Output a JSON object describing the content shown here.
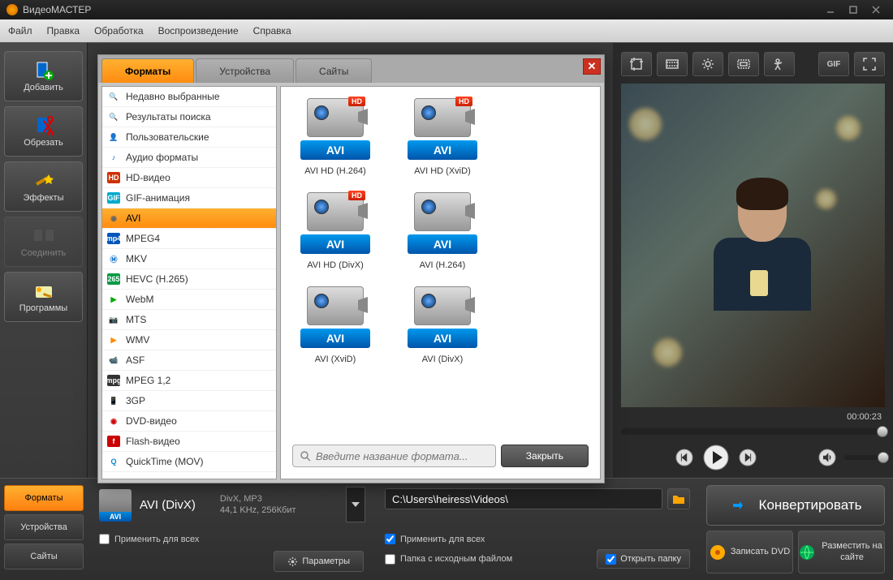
{
  "title": "ВидеоМАСТЕР",
  "menu": [
    "Файл",
    "Правка",
    "Обработка",
    "Воспроизведение",
    "Справка"
  ],
  "sidebar": {
    "items": [
      {
        "label": "Добавить",
        "name": "add-button"
      },
      {
        "label": "Обрезать",
        "name": "cut-button"
      },
      {
        "label": "Эффекты",
        "name": "effects-button"
      },
      {
        "label": "Соединить",
        "name": "join-button",
        "disabled": true
      },
      {
        "label": "Программы",
        "name": "programs-button"
      }
    ]
  },
  "preview": {
    "time": "00:00:23",
    "gif_label": "GIF"
  },
  "bottom_tabs": [
    "Форматы",
    "Устройства",
    "Сайты"
  ],
  "format": {
    "tag": "AVI",
    "name": "AVI (DivX)",
    "detail1": "DivX, MP3",
    "detail2": "44,1 KHz, 256Кбит",
    "apply_all": "Применить для всех",
    "params": "Параметры"
  },
  "path": {
    "value": "C:\\Users\\heiress\\Videos\\",
    "apply_all": "Применить для всех",
    "source_folder": "Папка с исходным файлом",
    "open_folder": "Открыть папку"
  },
  "actions": {
    "convert": "Конвертировать",
    "burn": "Записать DVD",
    "publish": "Разместить на сайте"
  },
  "popup": {
    "tabs": [
      "Форматы",
      "Устройства",
      "Сайты"
    ],
    "close_text": "Закрыть",
    "search_placeholder": "Введите название формата...",
    "sidebar": [
      {
        "label": "Недавно выбранные",
        "ico": "🔍",
        "bg": "",
        "fg": "#888"
      },
      {
        "label": "Результаты поиска",
        "ico": "🔍",
        "bg": "",
        "fg": "#888"
      },
      {
        "label": "Пользовательские",
        "ico": "👤",
        "bg": "",
        "fg": "#888"
      },
      {
        "label": "Аудио форматы",
        "ico": "♪",
        "bg": "",
        "fg": "#06c"
      },
      {
        "label": "HD-видео",
        "ico": "HD",
        "bg": "#d03000",
        "fg": "#fff"
      },
      {
        "label": "GIF-анимация",
        "ico": "GIF",
        "bg": "#00aacc",
        "fg": "#fff"
      },
      {
        "label": "AVI",
        "ico": "◉",
        "bg": "",
        "fg": "#666",
        "selected": true
      },
      {
        "label": "MPEG4",
        "ico": "mp4",
        "bg": "#0055bb",
        "fg": "#fff"
      },
      {
        "label": "MKV",
        "ico": "Ⓜ",
        "bg": "",
        "fg": "#06c"
      },
      {
        "label": "HEVC (H.265)",
        "ico": "265",
        "bg": "#009944",
        "fg": "#fff"
      },
      {
        "label": "WebM",
        "ico": "▶",
        "bg": "",
        "fg": "#0a0"
      },
      {
        "label": "MTS",
        "ico": "📷",
        "bg": "",
        "fg": "#555"
      },
      {
        "label": "WMV",
        "ico": "▶",
        "bg": "",
        "fg": "#f80"
      },
      {
        "label": "ASF",
        "ico": "📹",
        "bg": "",
        "fg": "#06c"
      },
      {
        "label": "MPEG 1,2",
        "ico": "mpg",
        "bg": "#333",
        "fg": "#fff"
      },
      {
        "label": "3GP",
        "ico": "📱",
        "bg": "",
        "fg": "#06c"
      },
      {
        "label": "DVD-видео",
        "ico": "◉",
        "bg": "",
        "fg": "#c00"
      },
      {
        "label": "Flash-видео",
        "ico": "f",
        "bg": "#c00",
        "fg": "#fff"
      },
      {
        "label": "QuickTime (MOV)",
        "ico": "Q",
        "bg": "",
        "fg": "#08c"
      }
    ],
    "grid": [
      {
        "label": "AVI HD (H.264)",
        "hd": true,
        "bar": "AVI"
      },
      {
        "label": "AVI HD (XviD)",
        "hd": true,
        "bar": "AVI"
      },
      {
        "label": "AVI HD (DivX)",
        "hd": true,
        "bar": "AVI"
      },
      {
        "label": "AVI (H.264)",
        "hd": false,
        "bar": "AVI"
      },
      {
        "label": "AVI (XviD)",
        "hd": false,
        "bar": "AVI"
      },
      {
        "label": "AVI (DivX)",
        "hd": false,
        "bar": "AVI"
      }
    ]
  }
}
